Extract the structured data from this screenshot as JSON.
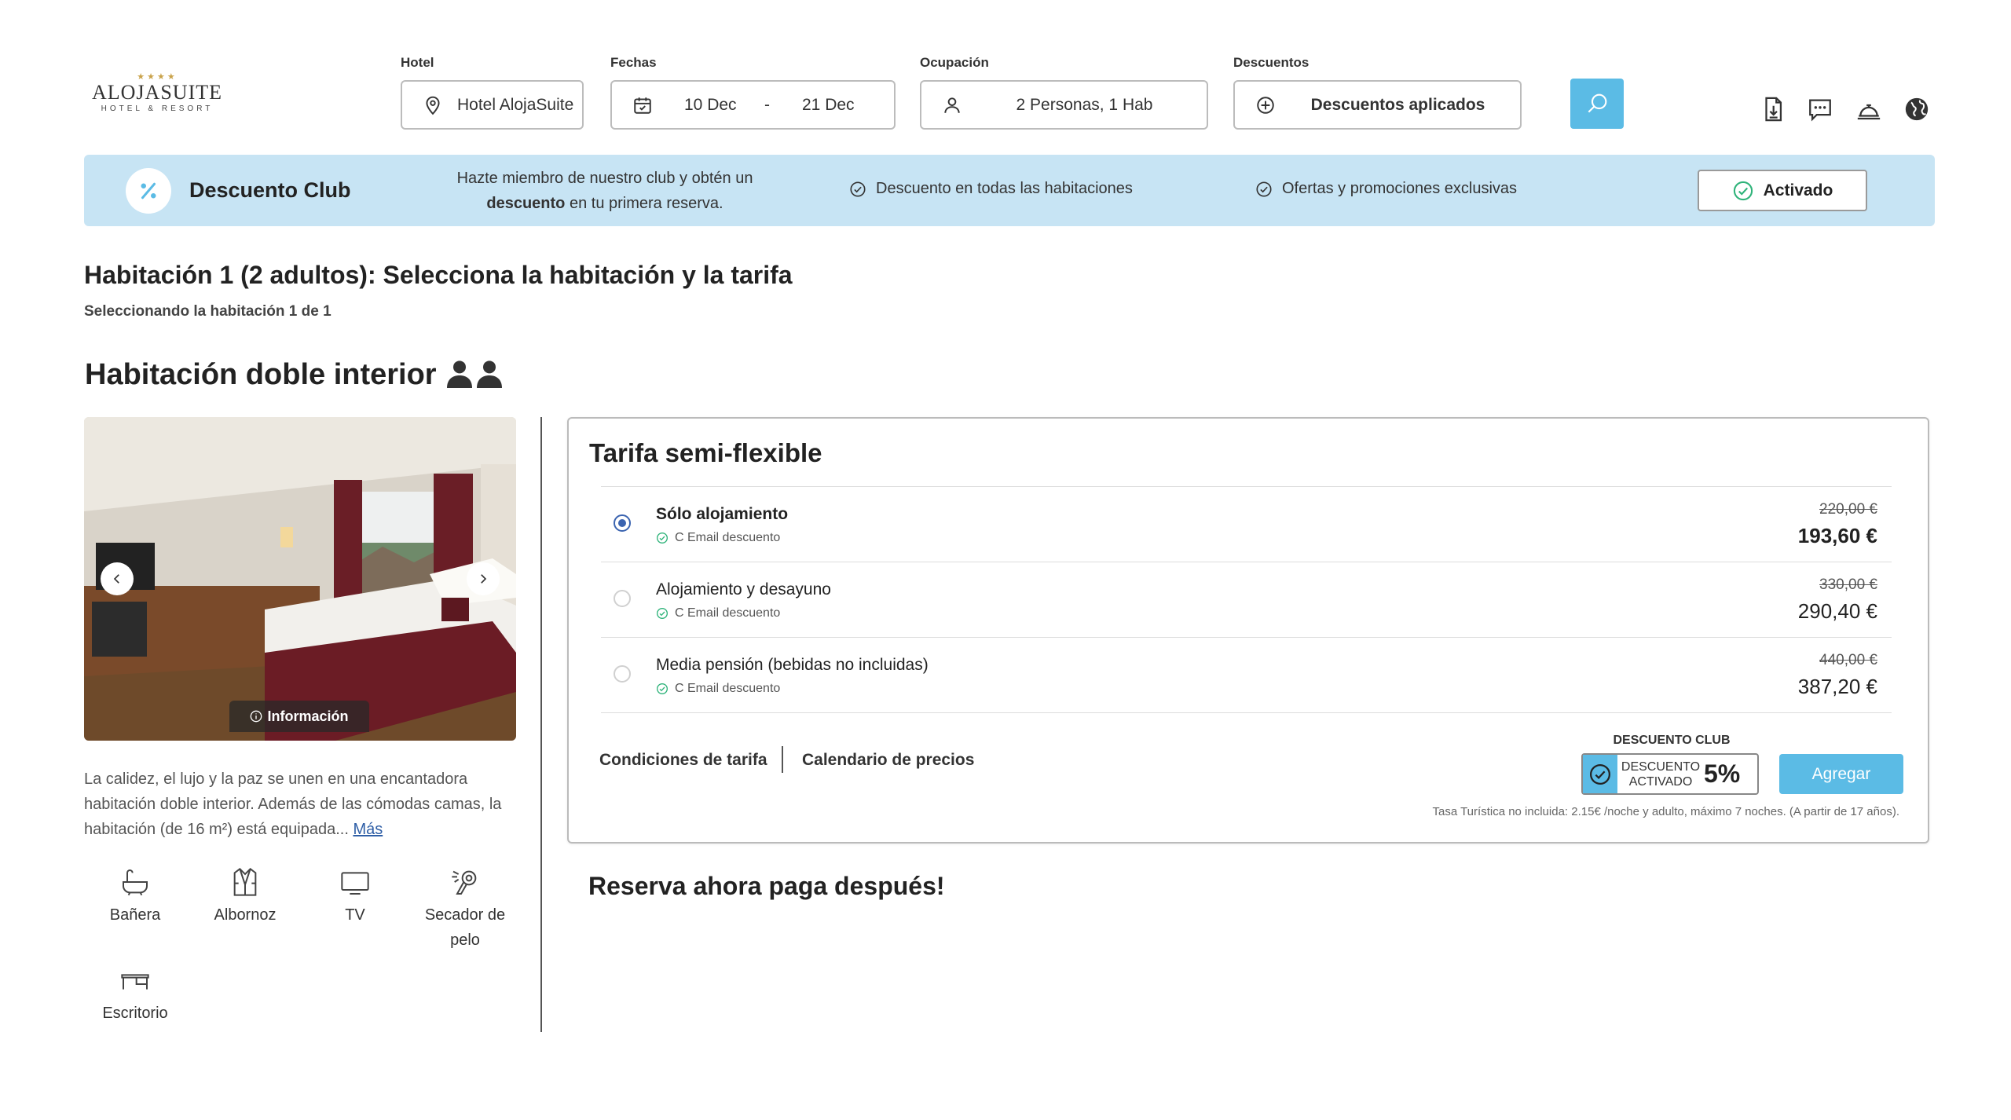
{
  "header": {
    "logo": {
      "stars": "★★★★",
      "name": "ALOJASUITE",
      "sub": "HOTEL & RESORT"
    },
    "hotel": {
      "label": "Hotel",
      "value": "Hotel AlojaSuite",
      "icon": "map-pin-icon"
    },
    "dates": {
      "label": "Fechas",
      "from": "10 Dec",
      "sep": "-",
      "to": "21 Dec",
      "icon": "calendar-icon"
    },
    "occupancy": {
      "label": "Ocupación",
      "value": "2 Personas, 1 Hab",
      "icon": "user-icon"
    },
    "discounts": {
      "label": "Descuentos",
      "value": "Descuentos aplicados",
      "icon": "plus-circle-icon"
    },
    "search_icon": "search-icon",
    "right_icons": [
      "document-download-icon",
      "chat-icon",
      "service-bell-icon",
      "globe-icon"
    ]
  },
  "club_banner": {
    "title": "Descuento Club",
    "promo_line1": "Hazte miembro de nuestro club y obtén un",
    "promo_bold": "descuento",
    "promo_rest": " en tu primera reserva.",
    "feature1": "Descuento en todas las habitaciones",
    "feature2": "Ofertas y promociones exclusivas",
    "button": "Activado",
    "bg_color": "#c7e4f4"
  },
  "room": {
    "heading": "Habitación 1 (2 adultos): Selecciona la habitación y la tarifa",
    "subheading": "Seleccionando la habitación 1 de 1",
    "name": "Habitación doble interior",
    "info_label": "Información",
    "description": "La calidez, el lujo y la paz se unen en una encantadora habitación doble interior. Además de las cómodas camas, la habitación (de 16 m²) está equipada...",
    "more_link": "Más",
    "amenities": [
      {
        "label": "Bañera",
        "icon": "bathtub-icon"
      },
      {
        "label": "Albornoz",
        "icon": "bathrobe-icon"
      },
      {
        "label": "TV",
        "icon": "tv-icon"
      },
      {
        "label": "Secador de pelo",
        "icon": "hair-dryer-icon"
      },
      {
        "label": "Escritorio",
        "icon": "desk-icon"
      }
    ]
  },
  "rate_card": {
    "title": "Tarifa semi-flexible",
    "options": [
      {
        "name": "Sólo alojamiento",
        "note": "C Email descuento",
        "old_price": "220,00 €",
        "price": "193,60 €",
        "selected": true
      },
      {
        "name": "Alojamiento y desayuno",
        "note": "C Email descuento",
        "old_price": "330,00 €",
        "price": "290,40 €",
        "selected": false
      },
      {
        "name": "Media pensión (bebidas no incluidas)",
        "note": "C Email descuento",
        "old_price": "440,00 €",
        "price": "387,20 €",
        "selected": false
      }
    ],
    "conditions_link": "Condiciones de tarifa",
    "calendar_link": "Calendario de precios",
    "club_label": "DESCUENTO CLUB",
    "club_status_line1": "DESCUENTO",
    "club_status_line2": "ACTIVADO",
    "club_percent": "5%",
    "add_button": "Agregar",
    "tax_note": "Tasa Turística no incluida: 2.15€ /noche y adulto, máximo 7 noches. (A partir de 17 años).",
    "accent_color": "#5bbbe5"
  },
  "footer_heading": "Reserva ahora paga después!"
}
